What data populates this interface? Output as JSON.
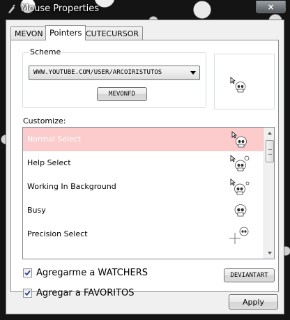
{
  "window": {
    "title": "Mouse Properties",
    "close_label": "×"
  },
  "tabs": [
    {
      "label": "MEVON",
      "active": false
    },
    {
      "label": "Pointers",
      "active": true
    },
    {
      "label": "CUTECURSOR",
      "active": false
    }
  ],
  "scheme": {
    "legend": "Scheme",
    "selected_value": "WWW.YOUTUBE.COM/USER/ARCOIRISTUTOS",
    "button_label": "MEVONFD"
  },
  "customize": {
    "label": "Customize:",
    "items": [
      {
        "label": "Normal Select",
        "selected": true,
        "cursor_icon": "skull-arrow-icon"
      },
      {
        "label": "Help Select",
        "selected": false,
        "cursor_icon": "skull-help-icon"
      },
      {
        "label": "Working In Background",
        "selected": false,
        "cursor_icon": "skull-busy-arrow-icon"
      },
      {
        "label": "Busy",
        "selected": false,
        "cursor_icon": "skull-icon"
      },
      {
        "label": "Precision Select",
        "selected": false,
        "cursor_icon": "skull-crosshair-icon"
      }
    ]
  },
  "options": {
    "watchers_label": "Agregarme a WATCHERS",
    "watchers_checked": true,
    "favoritos_label": "Agregar a FAVORITOS",
    "favoritos_checked": true,
    "deviantart_label": "DEVIANTART"
  },
  "footer": {
    "apply_label": "Apply"
  },
  "colors": {
    "selected_row": "#fccccc",
    "frame": "#141414",
    "client_bg": "#f0f0f0"
  }
}
